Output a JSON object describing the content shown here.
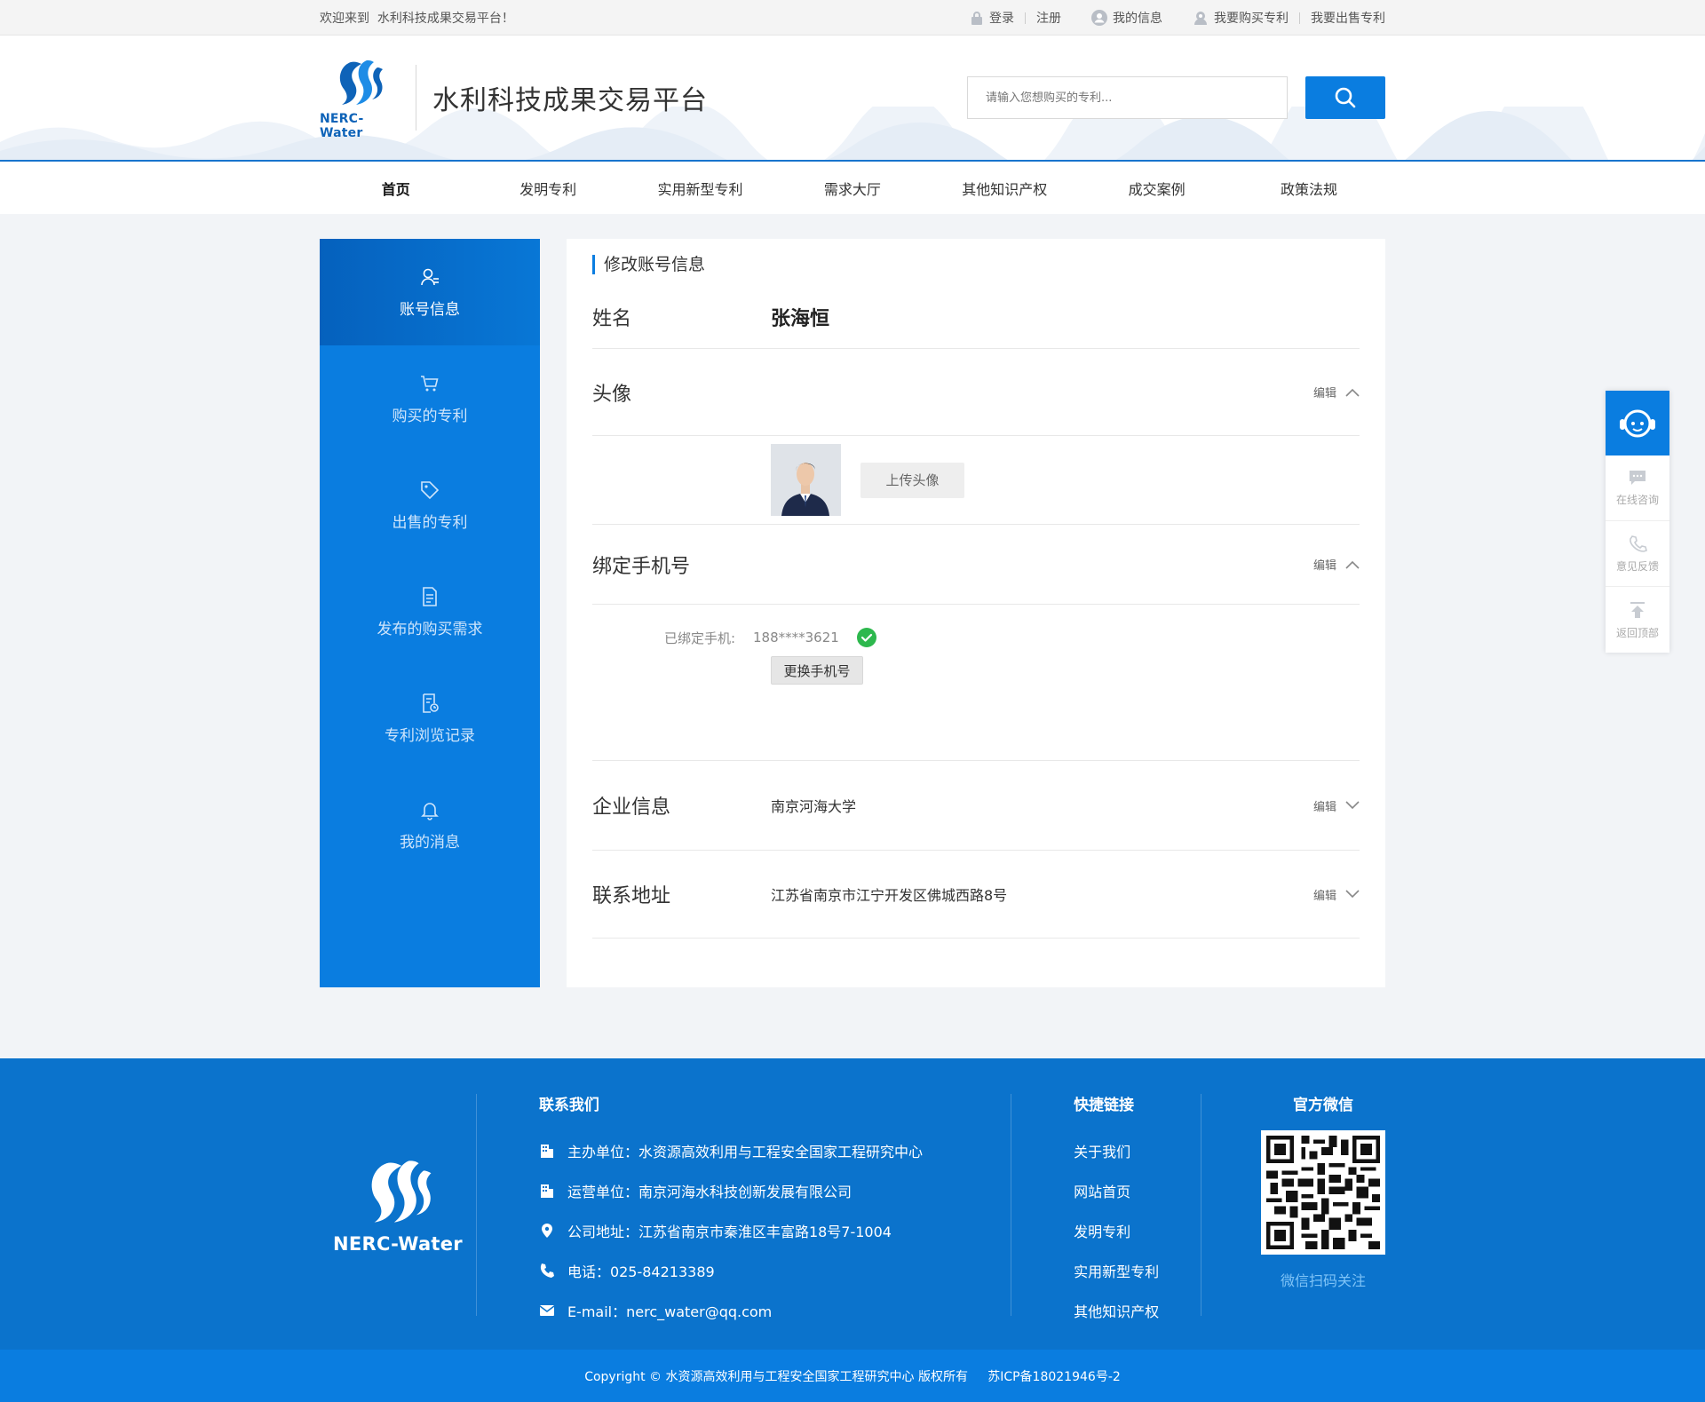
{
  "topbar": {
    "welcome": "欢迎来到  水利科技成果交易平台！",
    "login": "登录",
    "register": "注册",
    "my_info": "我的信息",
    "buy_patent": "我要购买专利",
    "sell_patent": "我要出售专利"
  },
  "header": {
    "logo_text": "NERC-Water",
    "site_title": "水利科技成果交易平台",
    "search_placeholder": "请输入您想购买的专利..."
  },
  "nav": {
    "items": [
      "首页",
      "发明专利",
      "实用新型专利",
      "需求大厅",
      "其他知识产权",
      "成交案例",
      "政策法规"
    ],
    "active_index": 0
  },
  "sidebar": {
    "items": [
      {
        "label": "账号信息",
        "icon": "user-icon"
      },
      {
        "label": "购买的专利",
        "icon": "cart-icon"
      },
      {
        "label": "出售的专利",
        "icon": "tag-icon"
      },
      {
        "label": "发布的购买需求",
        "icon": "document-icon"
      },
      {
        "label": "专利浏览记录",
        "icon": "history-icon"
      },
      {
        "label": "我的消息",
        "icon": "bell-icon"
      }
    ],
    "active_index": 0
  },
  "content": {
    "title": "修改账号信息",
    "name_label": "姓名",
    "name_value": "张海恒",
    "avatar_label": "头像",
    "upload_avatar": "上传头像",
    "phone_label": "绑定手机号",
    "bound_phone_key": "已绑定手机:",
    "bound_phone_value": "188****3621",
    "change_phone": "更换手机号",
    "company_label": "企业信息",
    "company_value": "南京河海大学",
    "address_label": "联系地址",
    "address_value": "江苏省南京市江宁开发区佛城西路8号",
    "edit": "编辑"
  },
  "float": {
    "online": "在线咨询",
    "feedback": "意见反馈",
    "top": "返回顶部"
  },
  "footer": {
    "logo_text": "NERC-Water",
    "contact_title": "联系我们",
    "contacts": [
      {
        "icon": "building-icon",
        "text": "主办单位：水资源高效利用与工程安全国家工程研究中心"
      },
      {
        "icon": "building-icon",
        "text": "运营单位：南京河海水科技创新发展有限公司"
      },
      {
        "icon": "location-icon",
        "text": "公司地址：江苏省南京市秦淮区丰富路18号7-1004"
      },
      {
        "icon": "phone-icon",
        "text": "电话：025-84213389"
      },
      {
        "icon": "mail-icon",
        "text": "E-mail：nerc_water@qq.com"
      }
    ],
    "quick_title": "快捷链接",
    "quick_links": [
      "关于我们",
      "网站首页",
      "发明专利",
      "实用新型专利",
      "其他知识产权"
    ],
    "wechat_title": "官方微信",
    "wechat_caption": "微信扫码关注",
    "copyright": "Copyright © 水资源高效利用与工程安全国家工程研究中心 版权所有     苏ICP备18021946号-2"
  },
  "colors": {
    "primary": "#0a7de0",
    "footer_bg": "#0b73cc",
    "check_green": "#2db84d"
  }
}
